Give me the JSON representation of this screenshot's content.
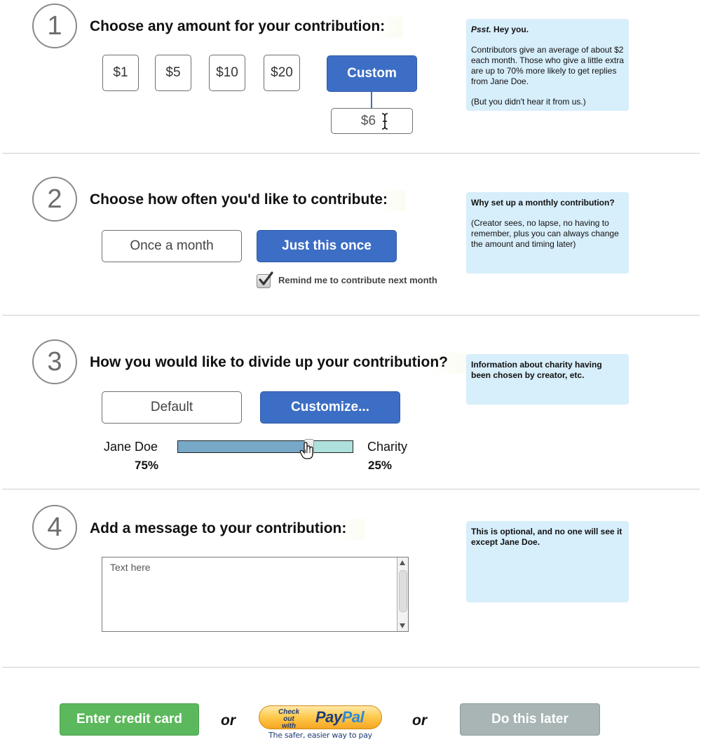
{
  "steps": [
    {
      "number": "1",
      "heading": "Choose any amount for your contribution:"
    },
    {
      "number": "2",
      "heading": "Choose how often you'd like to contribute:"
    },
    {
      "number": "3",
      "heading": "How you would like to divide up your contribution?"
    },
    {
      "number": "4",
      "heading": "Add a message to your contribution:"
    }
  ],
  "amount": {
    "options": [
      "$1",
      "$5",
      "$10",
      "$20"
    ],
    "custom_label": "Custom",
    "custom_value": "$6"
  },
  "note1": {
    "lead_italic": "Psst.",
    "lead_bold": " Hey you.",
    "body": "Contributors give an average of about $2 each month. Those who give a little extra are up to 70% more likely to get replies from Jane Doe.",
    "aside": "(But you didn't hear it from us.)"
  },
  "frequency": {
    "monthly_label": "Once a month",
    "once_label": "Just this once",
    "remind_label": "Remind me to contribute next month",
    "remind_checked": true
  },
  "note2": {
    "title": "Why set up a monthly contribution?",
    "body": "(Creator sees, no lapse, no having to remember, plus you can always change the amount and timing later)"
  },
  "divide": {
    "default_label": "Default",
    "customize_label": "Customize...",
    "left_name": "Jane Doe",
    "left_percent": "75%",
    "right_name": "Charity",
    "right_percent": "25%",
    "split_fraction": 0.75
  },
  "note3": {
    "title": "Information about charity having been chosen by creator, etc."
  },
  "message": {
    "placeholder": "Text here"
  },
  "note4": {
    "title": "This is optional, and no one will see it except Jane Doe."
  },
  "footer": {
    "credit_label": "Enter credit card",
    "or_1": "or",
    "paypal_checkout": "Check out",
    "paypal_with": "with",
    "paypal_brand_pay": "Pay",
    "paypal_brand_pal": "Pal",
    "paypal_tagline": "The safer, easier way to pay",
    "or_2": "or",
    "later_label": "Do this later"
  },
  "colors": {
    "primary_blue": "#3d6ec5",
    "note_bg": "#d7eefb",
    "credit_green": "#5cb85c",
    "later_gray": "#a9b5b5",
    "slider_left": "#78a8c8",
    "slider_right": "#aee0de"
  },
  "icons": [
    "text-cursor-icon",
    "checkmark-icon",
    "hand-pointer-icon",
    "scroll-up-icon",
    "scroll-down-icon"
  ]
}
